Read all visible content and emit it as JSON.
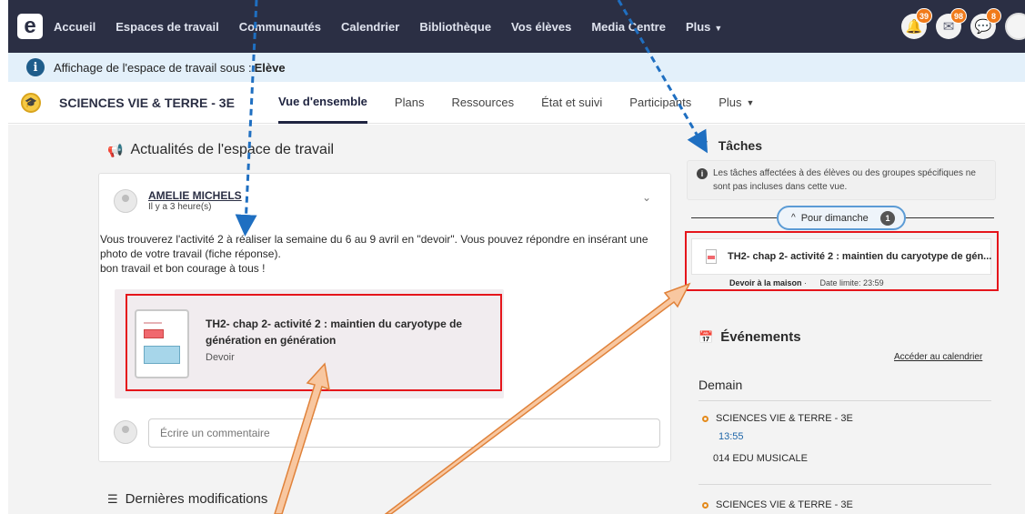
{
  "nav": {
    "logo": "e",
    "items": [
      "Accueil",
      "Espaces de travail",
      "Communautés",
      "Calendrier",
      "Bibliothèque",
      "Vos élèves",
      "Media Centre",
      "Plus"
    ],
    "badges": [
      "39",
      "98",
      "8"
    ]
  },
  "info_bar": {
    "icon": "i",
    "text": "Affichage de l'espace de travail sous : ",
    "role": "Elève"
  },
  "workspace": {
    "title": "SCIENCES VIE & TERRE - 3E",
    "tabs": [
      "Vue d'ensemble",
      "Plans",
      "Ressources",
      "État et suivi",
      "Participants",
      "Plus"
    ]
  },
  "news": {
    "title": "Actualités de l'espace de travail",
    "author": "AMELIE MICHELS",
    "time": "Il y a 3 heure(s)",
    "text": "Vous trouverez l'activité 2 à réaliser la semaine du 6 au 9 avril en \"devoir\". Vous pouvez répondre en insérant une photo de votre travail (fiche réponse).",
    "text2": "bon travail et bon courage à tous !",
    "attachment_title": "TH2- chap 2- activité 2 : maintien du caryotype de génération en génération",
    "attachment_type": "Devoir",
    "comment_placeholder": "Écrire un commentaire"
  },
  "recent_changes_title": "Dernières modifications",
  "tasks": {
    "title": "Tâches",
    "note": "Les tâches affectées à des élèves ou des groupes spécifiques ne sont pas incluses dans cette vue.",
    "due_label": "Pour dimanche",
    "due_count": "1",
    "task_title": "TH2- chap 2- activité 2 : maintien du caryotype de gén...",
    "task_kind": "Devoir à la maison",
    "task_deadline": "Date limite: 23:59"
  },
  "events": {
    "title": "Événements",
    "calendar_link": "Accéder au calendrier",
    "day_label": "Demain",
    "items": [
      {
        "course": "SCIENCES VIE & TERRE - 3E",
        "time": "13:55",
        "room": "014 EDU MUSICALE"
      },
      {
        "course": "SCIENCES VIE & TERRE - 3E"
      }
    ]
  },
  "colors": {
    "nav_bg": "#2b2f44",
    "badge": "#f07a1a",
    "highlight_box": "#e5151b",
    "arrow_blue": "#1f6fc1",
    "arrow_orange": "#f7b98a"
  }
}
